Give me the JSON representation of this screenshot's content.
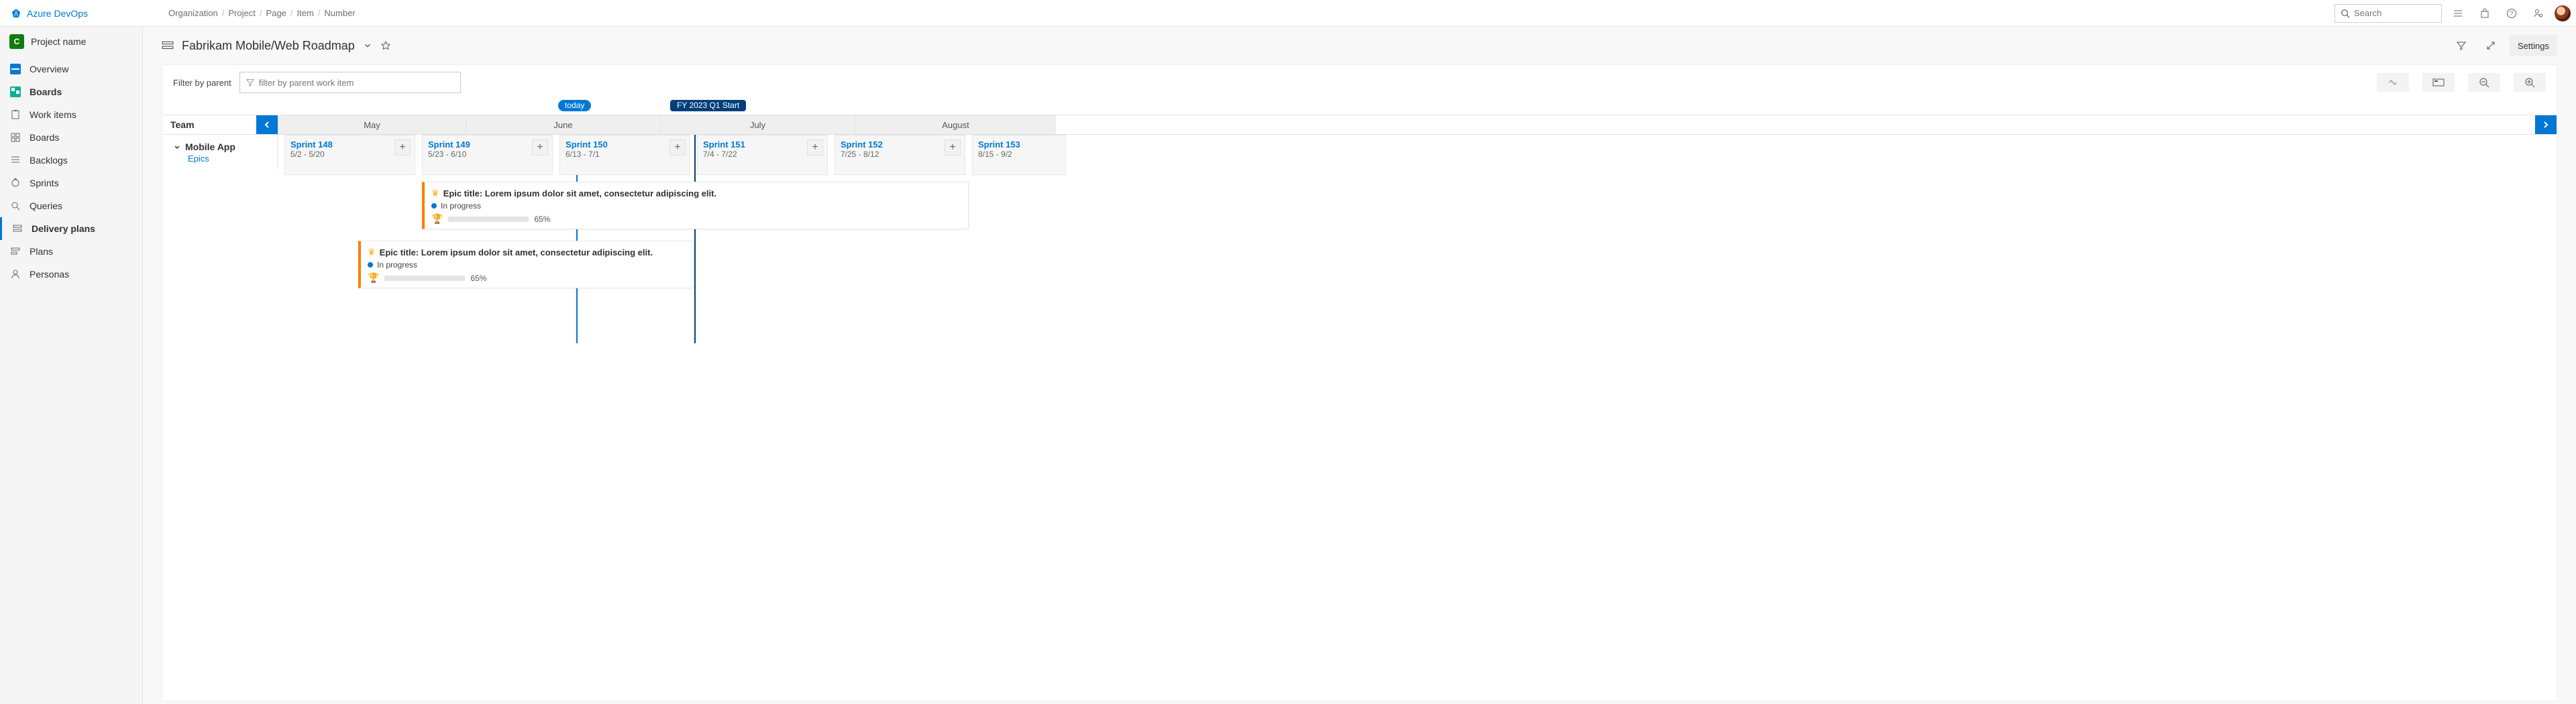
{
  "brand": "Azure DevOps",
  "breadcrumbs": [
    "Organization",
    "Project",
    "Page",
    "Item",
    "Number"
  ],
  "search": {
    "placeholder": "Search"
  },
  "project": {
    "initial": "C",
    "name": "Project name"
  },
  "nav": {
    "overview": "Overview",
    "boards": "Boards",
    "work_items": "Work items",
    "boards_sub": "Boards",
    "backlogs": "Backlogs",
    "sprints": "Sprints",
    "queries": "Queries",
    "delivery": "Delivery plans",
    "plans": "Plans",
    "personas": "Personas"
  },
  "page": {
    "title": "Fabrikam Mobile/Web Roadmap",
    "settings": "Settings",
    "filter_label": "Filter by parent",
    "filter_placeholder": "filter by parent work item",
    "team_header": "Team",
    "months": [
      "May",
      "June",
      "July",
      "August"
    ],
    "today_label": "today",
    "milestone_label": "FY 2023 Q1 Start"
  },
  "team": {
    "name": "Mobile App",
    "type": "Epics"
  },
  "sprints": [
    {
      "name": "Sprint 148",
      "dates": "5/2 - 5/20"
    },
    {
      "name": "Sprint 149",
      "dates": "5/23 - 6/10"
    },
    {
      "name": "Sprint 150",
      "dates": "6/13 - 7/1"
    },
    {
      "name": "Sprint 151",
      "dates": "7/4 - 7/22"
    },
    {
      "name": "Sprint 152",
      "dates": "7/25 - 8/12"
    },
    {
      "name": "Sprint 153",
      "dates": "8/15 - 9/2"
    }
  ],
  "epics": [
    {
      "title": "Epic title: Lorem ipsum dolor sit amet, consectetur adipiscing elit.",
      "status": "In progress",
      "pct": "65%"
    },
    {
      "title": "Epic title: Lorem ipsum dolor sit amet, consectetur adipiscing elit.",
      "status": "In progress",
      "pct": "65%"
    }
  ]
}
